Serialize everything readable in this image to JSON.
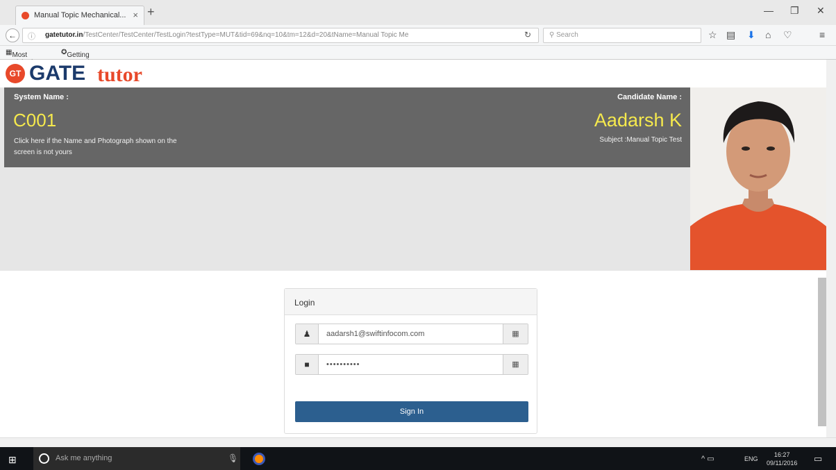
{
  "browser": {
    "tab_title": "Manual Topic Mechanical...",
    "tab_close": "×",
    "new_tab": "+",
    "url_domain": "gatetutor.in",
    "url_path": "/TestCenter/TestCenter/TestLogin?testType=MUT&tid=69&nq=10&tm=12&d=20&tName=Manual Topic Me",
    "search_placeholder": "Search",
    "bookmarks": [
      "Most Visited",
      "Getting Started"
    ]
  },
  "logo": {
    "badge": "GT",
    "gate": "GATE",
    "tutor": "tutor"
  },
  "header": {
    "system_label": "System Name :",
    "system_value": "C001",
    "note": "Click here if the Name and Photograph shown on the screen is not yours",
    "candidate_label": "Candidate Name :",
    "candidate_value": "Aadarsh K",
    "subject": "Subject :Manual Topic Test"
  },
  "login": {
    "title": "Login",
    "email_value": "aadarsh1@swiftinfocom.com",
    "password_value": "••••••••••",
    "signin_label": "Sign In"
  },
  "taskbar": {
    "search_text": "Ask me anything",
    "language": "ENG",
    "time": "16:27",
    "date": "09/11/2016"
  },
  "colors": {
    "accent_yellow": "#f5e94d",
    "header_gray": "#666666",
    "button_blue": "#2c5f8f",
    "logo_red": "#e8492a",
    "logo_navy": "#1b3a6b"
  }
}
